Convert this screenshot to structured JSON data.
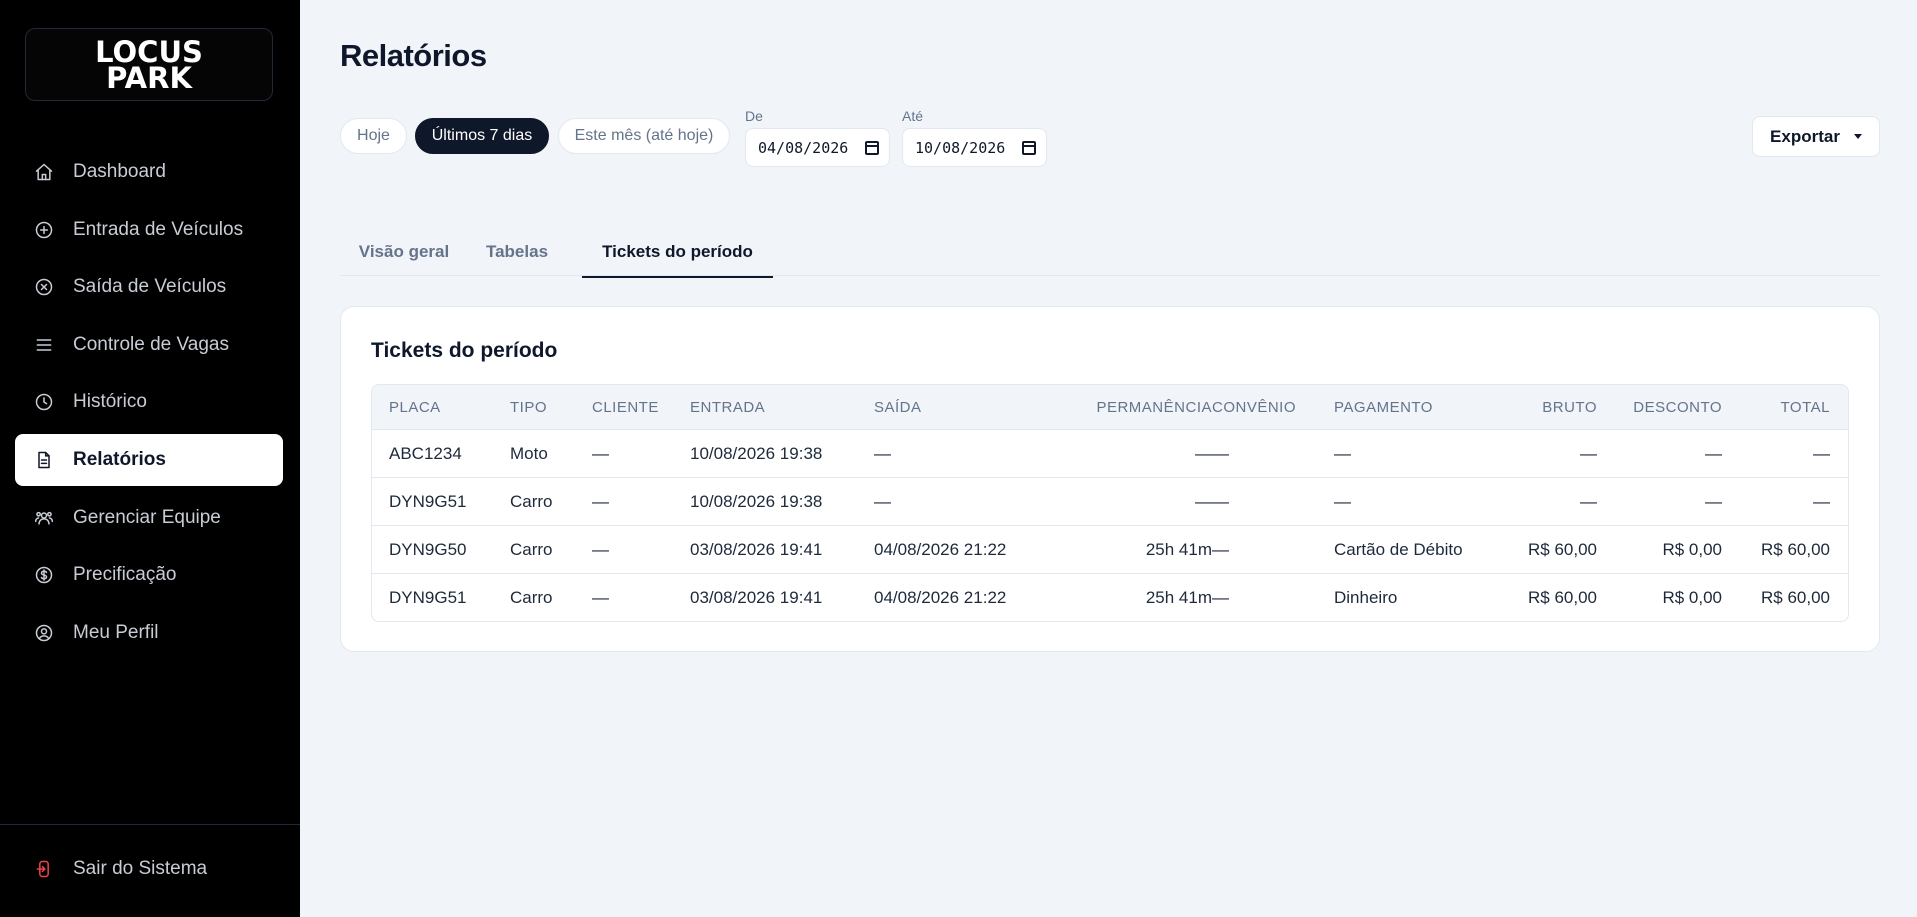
{
  "brand": {
    "line1": "LOCUS",
    "line2": "PARK"
  },
  "sidebar": {
    "items": [
      {
        "label": "Dashboard",
        "icon": "home-icon"
      },
      {
        "label": "Entrada de Veículos",
        "icon": "plus-circle-icon"
      },
      {
        "label": "Saída de Veículos",
        "icon": "x-circle-icon"
      },
      {
        "label": "Controle de Vagas",
        "icon": "menu-icon"
      },
      {
        "label": "Histórico",
        "icon": "clock-icon"
      },
      {
        "label": "Relatórios",
        "icon": "file-icon",
        "active": true
      },
      {
        "label": "Gerenciar Equipe",
        "icon": "users-icon"
      },
      {
        "label": "Precificação",
        "icon": "dollar-circle-icon"
      },
      {
        "label": "Meu Perfil",
        "icon": "user-circle-icon"
      }
    ],
    "logout": "Sair do Sistema"
  },
  "page": {
    "title": "Relatórios"
  },
  "filters": {
    "presets": [
      "Hoje",
      "Últimos 7 dias",
      "Este mês (até hoje)"
    ],
    "active_preset": "Últimos 7 dias",
    "from_label": "De",
    "from_value": "04/08/2026",
    "to_label": "Até",
    "to_value": "10/08/2026",
    "export_label": "Exportar"
  },
  "tabs": [
    "Visão geral",
    "Tabelas",
    "Tickets do período"
  ],
  "active_tab": "Tickets do período",
  "tickets": {
    "title": "Tickets do período",
    "columns": [
      "PLACA",
      "TIPO",
      "CLIENTE",
      "ENTRADA",
      "SAÍDA",
      "PERMANÊNCIA",
      "CONVÊNIO",
      "PAGAMENTO",
      "BRUTO",
      "DESCONTO",
      "TOTAL"
    ],
    "rows": [
      [
        "ABC1234",
        "Moto",
        "—",
        "10/08/2026 19:38",
        "—",
        "—",
        "—",
        "—",
        "—",
        "—",
        "—"
      ],
      [
        "DYN9G51",
        "Carro",
        "—",
        "10/08/2026 19:38",
        "—",
        "—",
        "—",
        "—",
        "—",
        "—",
        "—"
      ],
      [
        "DYN9G50",
        "Carro",
        "—",
        "03/08/2026 19:41",
        "04/08/2026 21:22",
        "25h 41m",
        "—",
        "Cartão de Débito",
        "R$ 60,00",
        "R$ 0,00",
        "R$ 60,00"
      ],
      [
        "DYN9G51",
        "Carro",
        "—",
        "03/08/2026 19:41",
        "04/08/2026 21:22",
        "25h 41m",
        "—",
        "Dinheiro",
        "R$ 60,00",
        "R$ 0,00",
        "R$ 60,00"
      ]
    ]
  },
  "colors": {
    "sidebar": "#000000",
    "accent": "#0f172a",
    "background": "#f1f4f8",
    "logout_icon": "#ef4444"
  }
}
